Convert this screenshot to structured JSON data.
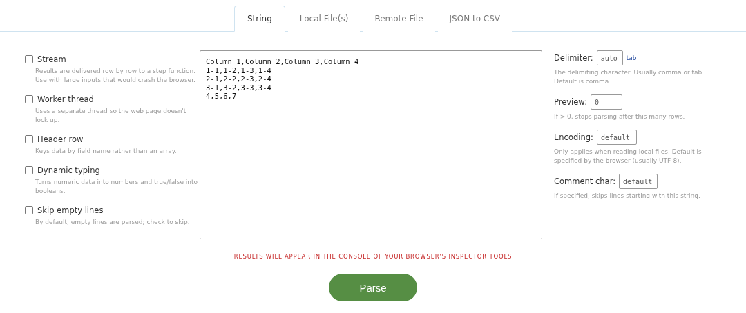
{
  "tabs": [
    {
      "label": "String",
      "selected": true
    },
    {
      "label": "Local File(s)",
      "selected": false
    },
    {
      "label": "Remote File",
      "selected": false
    },
    {
      "label": "JSON to CSV",
      "selected": false
    }
  ],
  "checkbox_options": [
    {
      "label": "Stream",
      "checked": false,
      "hint": "Results are delivered row by row to a step function. Use with large inputs that would crash the browser."
    },
    {
      "label": "Worker thread",
      "checked": false,
      "hint": "Uses a separate thread so the web page doesn't lock up."
    },
    {
      "label": "Header row",
      "checked": false,
      "hint": "Keys data by field name rather than an array."
    },
    {
      "label": "Dynamic typing",
      "checked": false,
      "hint": "Turns numeric data into numbers and true/false into booleans."
    },
    {
      "label": "Skip empty lines",
      "checked": false,
      "hint": "By default, empty lines are parsed; check to skip."
    }
  ],
  "input": {
    "value": "Column 1,Column 2,Column 3,Column 4\n1-1,1-2,1-3,1-4\n2-1,2-2,2-3,2-4\n3-1,3-2,3-3,3-4\n4,5,6,7"
  },
  "field_options": [
    {
      "label": "Delimiter:",
      "value": "auto",
      "link": "tab",
      "hint": "The delimiting character. Usually comma or tab. Default is comma."
    },
    {
      "label": "Preview:",
      "value": "0",
      "hint": "If > 0, stops parsing after this many rows."
    },
    {
      "label": "Encoding:",
      "value": "default",
      "hint": "Only applies when reading local files. Default is specified by the browser (usually UTF-8)."
    },
    {
      "label": "Comment char:",
      "value": "default",
      "hint": "If specified, skips lines starting with this string."
    }
  ],
  "notice": "RESULTS WILL APPEAR IN THE CONSOLE OF YOUR BROWSER'S INSPECTOR TOOLS",
  "parse_button": "Parse"
}
